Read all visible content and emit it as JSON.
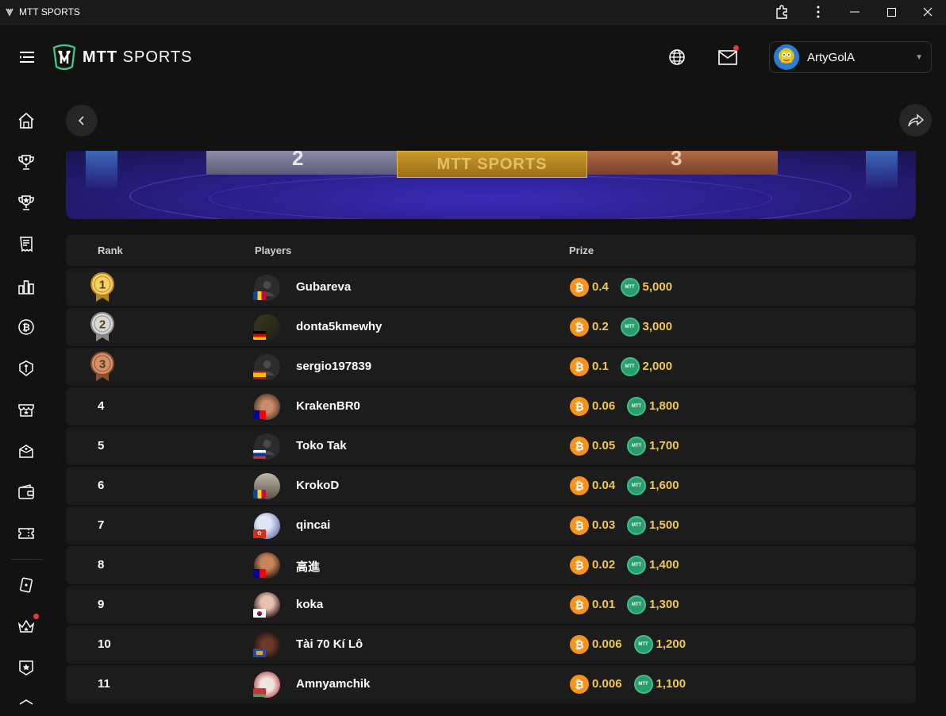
{
  "window": {
    "title": "MTT SPORTS"
  },
  "header": {
    "logo_text_bold": "MTT",
    "logo_text_rest": " SPORTS",
    "username": "ArtyGolA"
  },
  "banner": {
    "silver_num": "2",
    "gold_text": "MTT SPORTS",
    "bronze_num": "3"
  },
  "table": {
    "headers": {
      "rank": "Rank",
      "players": "Players",
      "prize": "Prize"
    },
    "rows": [
      {
        "rank": "1",
        "name": "Gubareva",
        "btc": "0.4",
        "mtt": "5,000",
        "flag": "md",
        "medal": "gold"
      },
      {
        "rank": "2",
        "name": "donta5kmewhy",
        "btc": "0.2",
        "mtt": "3,000",
        "flag": "de",
        "medal": "silver"
      },
      {
        "rank": "3",
        "name": "sergio197839",
        "btc": "0.1",
        "mtt": "2,000",
        "flag": "es",
        "medal": "bronze"
      },
      {
        "rank": "4",
        "name": "KrakenBR0",
        "btc": "0.06",
        "mtt": "1,800",
        "flag": "tw"
      },
      {
        "rank": "5",
        "name": "Toko Tak",
        "btc": "0.05",
        "mtt": "1,700",
        "flag": "ru"
      },
      {
        "rank": "6",
        "name": "KrokoD",
        "btc": "0.04",
        "mtt": "1,600",
        "flag": "md"
      },
      {
        "rank": "7",
        "name": "qincai",
        "btc": "0.03",
        "mtt": "1,500",
        "flag": "hk"
      },
      {
        "rank": "8",
        "name": "高進",
        "btc": "0.02",
        "mtt": "1,400",
        "flag": "tw"
      },
      {
        "rank": "9",
        "name": "koka",
        "btc": "0.01",
        "mtt": "1,300",
        "flag": "kr"
      },
      {
        "rank": "10",
        "name": "Tài 70 Kí Lô",
        "btc": "0.006",
        "mtt": "1,200",
        "flag": "xk"
      },
      {
        "rank": "11",
        "name": "Amnyamchik",
        "btc": "0.006",
        "mtt": "1,100",
        "flag": "by"
      }
    ]
  },
  "icons": {
    "btc_symbol": "₿",
    "mtt_symbol": "MTT"
  },
  "colors": {
    "accent_gold": "#f2c94c",
    "btc_orange": "#f7931a",
    "mtt_green": "#2a9d6c",
    "notify_red": "#e53935"
  }
}
